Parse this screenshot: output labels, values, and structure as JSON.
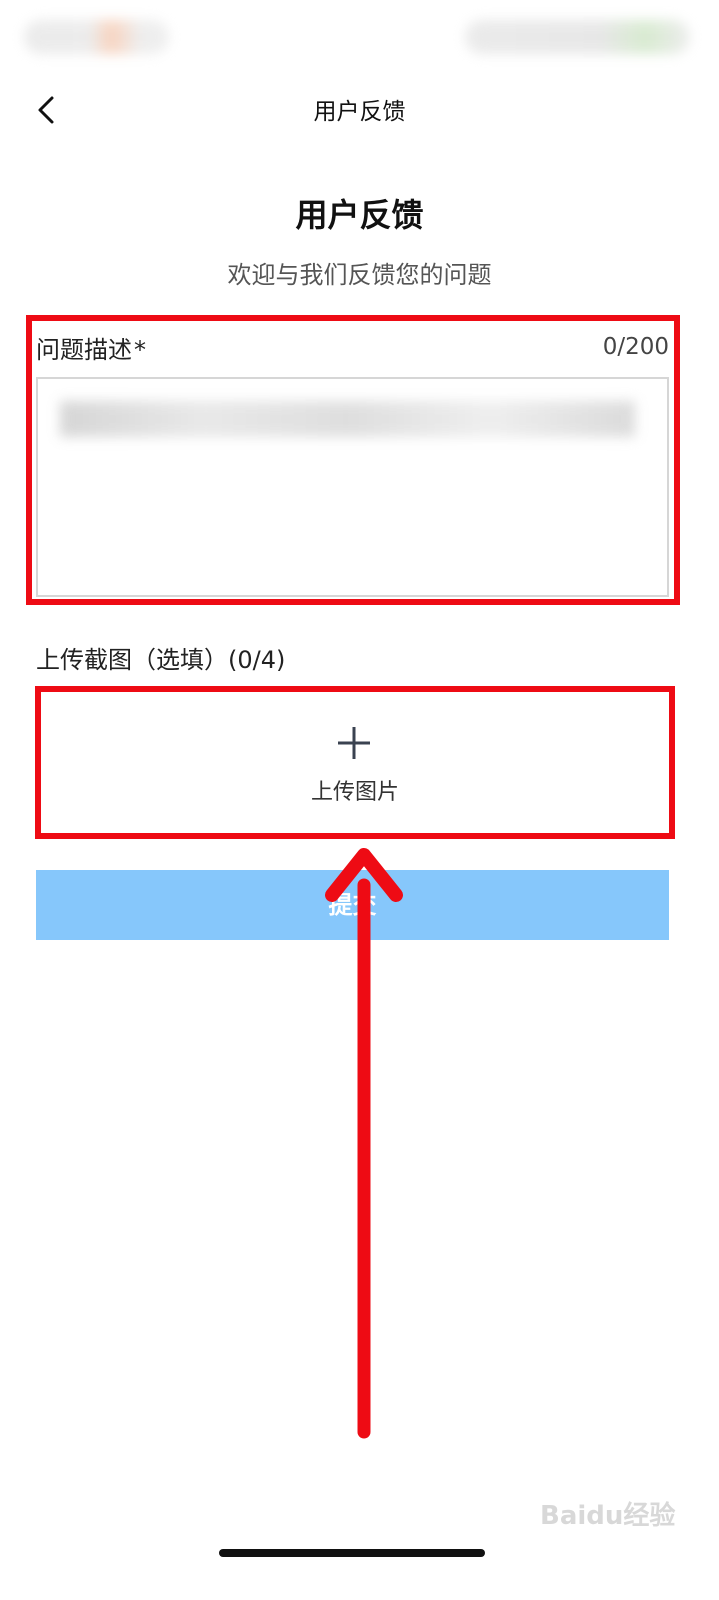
{
  "navbar": {
    "title": "用户反馈"
  },
  "hero": {
    "title": "用户反馈",
    "subtitle": "欢迎与我们反馈您的问题"
  },
  "description": {
    "label": "问题描述",
    "required_mark": "*",
    "counter": "0/200",
    "value": ""
  },
  "upload": {
    "label": "上传截图（选填）(0/4)",
    "button_label": "上传图片"
  },
  "submit": {
    "label": "提交"
  },
  "annotation": {
    "color": "#ee0b14"
  },
  "watermark": {
    "text": "Baidu经验"
  },
  "colors": {
    "submit_bg": "#86c7fb",
    "highlight": "#ee0b14"
  },
  "icons": {
    "back": "chevron-left-icon",
    "upload": "plus-icon"
  }
}
